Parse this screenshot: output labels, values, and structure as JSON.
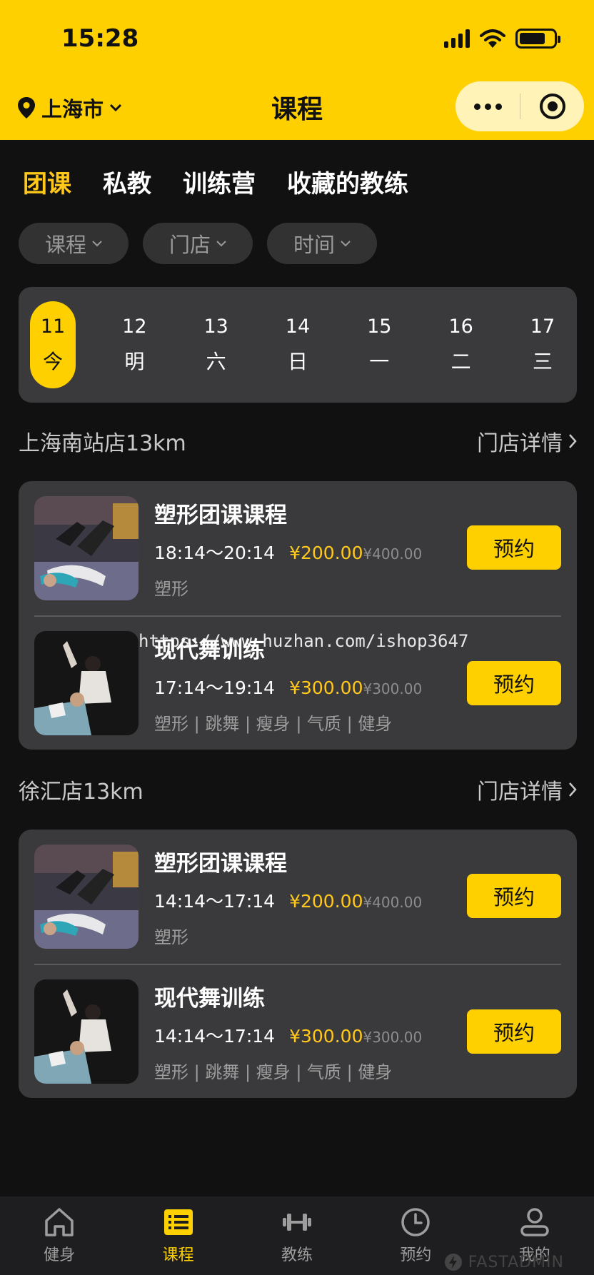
{
  "status_bar": {
    "time": "15:28"
  },
  "header": {
    "location": "上海市",
    "title": "课程"
  },
  "tabs": [
    {
      "label": "团课",
      "active": true
    },
    {
      "label": "私教",
      "active": false
    },
    {
      "label": "训练营",
      "active": false
    },
    {
      "label": "收藏的教练",
      "active": false
    }
  ],
  "filters": [
    {
      "label": "课程"
    },
    {
      "label": "门店"
    },
    {
      "label": "时间"
    }
  ],
  "dates": [
    {
      "day": "11",
      "weekday": "今",
      "active": true
    },
    {
      "day": "12",
      "weekday": "明",
      "active": false
    },
    {
      "day": "13",
      "weekday": "六",
      "active": false
    },
    {
      "day": "14",
      "weekday": "日",
      "active": false
    },
    {
      "day": "15",
      "weekday": "一",
      "active": false
    },
    {
      "day": "16",
      "weekday": "二",
      "active": false
    },
    {
      "day": "17",
      "weekday": "三",
      "active": false
    }
  ],
  "stores": [
    {
      "name": "上海南站店13km",
      "detail_label": "门店详情",
      "courses": [
        {
          "name": "塑形团课课程",
          "time": "18:14～20:14",
          "price": "¥200.00",
          "original_price": "¥400.00",
          "tags": "塑形",
          "book_label": "预约"
        },
        {
          "name": "现代舞训练",
          "time": "17:14～19:14",
          "price": "¥300.00",
          "original_price": "¥300.00",
          "tags": "塑形 | 跳舞 | 瘦身 | 气质 | 健身",
          "book_label": "预约"
        }
      ]
    },
    {
      "name": "徐汇店13km",
      "detail_label": "门店详情",
      "courses": [
        {
          "name": "塑形团课课程",
          "time": "14:14～17:14",
          "price": "¥200.00",
          "original_price": "¥400.00",
          "tags": "塑形",
          "book_label": "预约"
        },
        {
          "name": "现代舞训练",
          "time": "14:14～17:14",
          "price": "¥300.00",
          "original_price": "¥300.00",
          "tags": "塑形 | 跳舞 | 瘦身 | 气质 | 健身",
          "book_label": "预约"
        }
      ]
    }
  ],
  "watermark": "https://www.huzhan.com/ishop3647",
  "tabbar": [
    {
      "label": "健身",
      "icon": "home-icon",
      "active": false
    },
    {
      "label": "课程",
      "icon": "list-icon",
      "active": true
    },
    {
      "label": "教练",
      "icon": "dumbbell-icon",
      "active": false
    },
    {
      "label": "预约",
      "icon": "clock-icon",
      "active": false
    },
    {
      "label": "我的",
      "icon": "user-icon",
      "active": false
    }
  ],
  "brand_mark": "FASTADMIN",
  "colors": {
    "accent": "#FFD000",
    "price": "#FFC81A",
    "background": "#111111",
    "card": "#3a3a3c"
  }
}
